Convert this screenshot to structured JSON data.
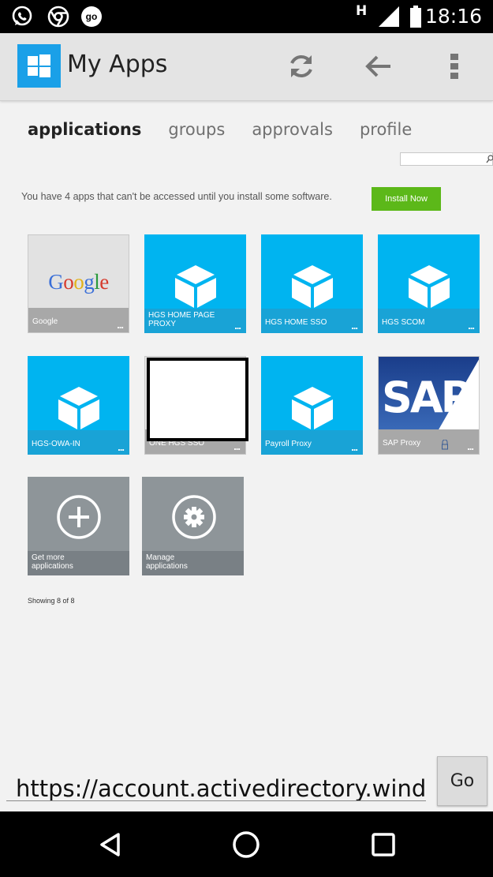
{
  "status_bar": {
    "network": "H",
    "time": "18:16",
    "notification_icons": [
      "whatsapp-icon",
      "chrome-icon",
      "go-icon"
    ]
  },
  "app_bar": {
    "title": "My Apps",
    "actions": [
      "refresh-icon",
      "back-arrow-icon",
      "overflow-menu-icon"
    ]
  },
  "tabs": [
    {
      "label": "applications",
      "active": true
    },
    {
      "label": "groups",
      "active": false
    },
    {
      "label": "approvals",
      "active": false
    },
    {
      "label": "profile",
      "active": false
    }
  ],
  "search": {
    "placeholder": ""
  },
  "banner": {
    "text": "You have 4 apps that can't be accessed until you install some software.",
    "button": "Install Now"
  },
  "apps": [
    {
      "label": "Google",
      "logo_text": "Google"
    },
    {
      "label": "HGS HOME PAGE PROXY"
    },
    {
      "label": "HGS HOME SSO"
    },
    {
      "label": "HGS SCOM"
    },
    {
      "label": "HGS-OWA-IN"
    },
    {
      "label": "ONE HGS SSO"
    },
    {
      "label": "Payroll Proxy"
    },
    {
      "label": "SAP Proxy",
      "logo_text": "SAP"
    }
  ],
  "more_menu": "...",
  "actions_tiles": [
    {
      "label": "Get more applications"
    },
    {
      "label": "Manage applications"
    }
  ],
  "showing": "Showing 8 of 8",
  "url_bar": {
    "url": "https://account.activedirectory.windowsazure.com",
    "go": "Go"
  },
  "colors": {
    "tile_blue": "#00b4f0",
    "install_green": "#5cb819",
    "logo_blue": "#1aa0e8"
  }
}
